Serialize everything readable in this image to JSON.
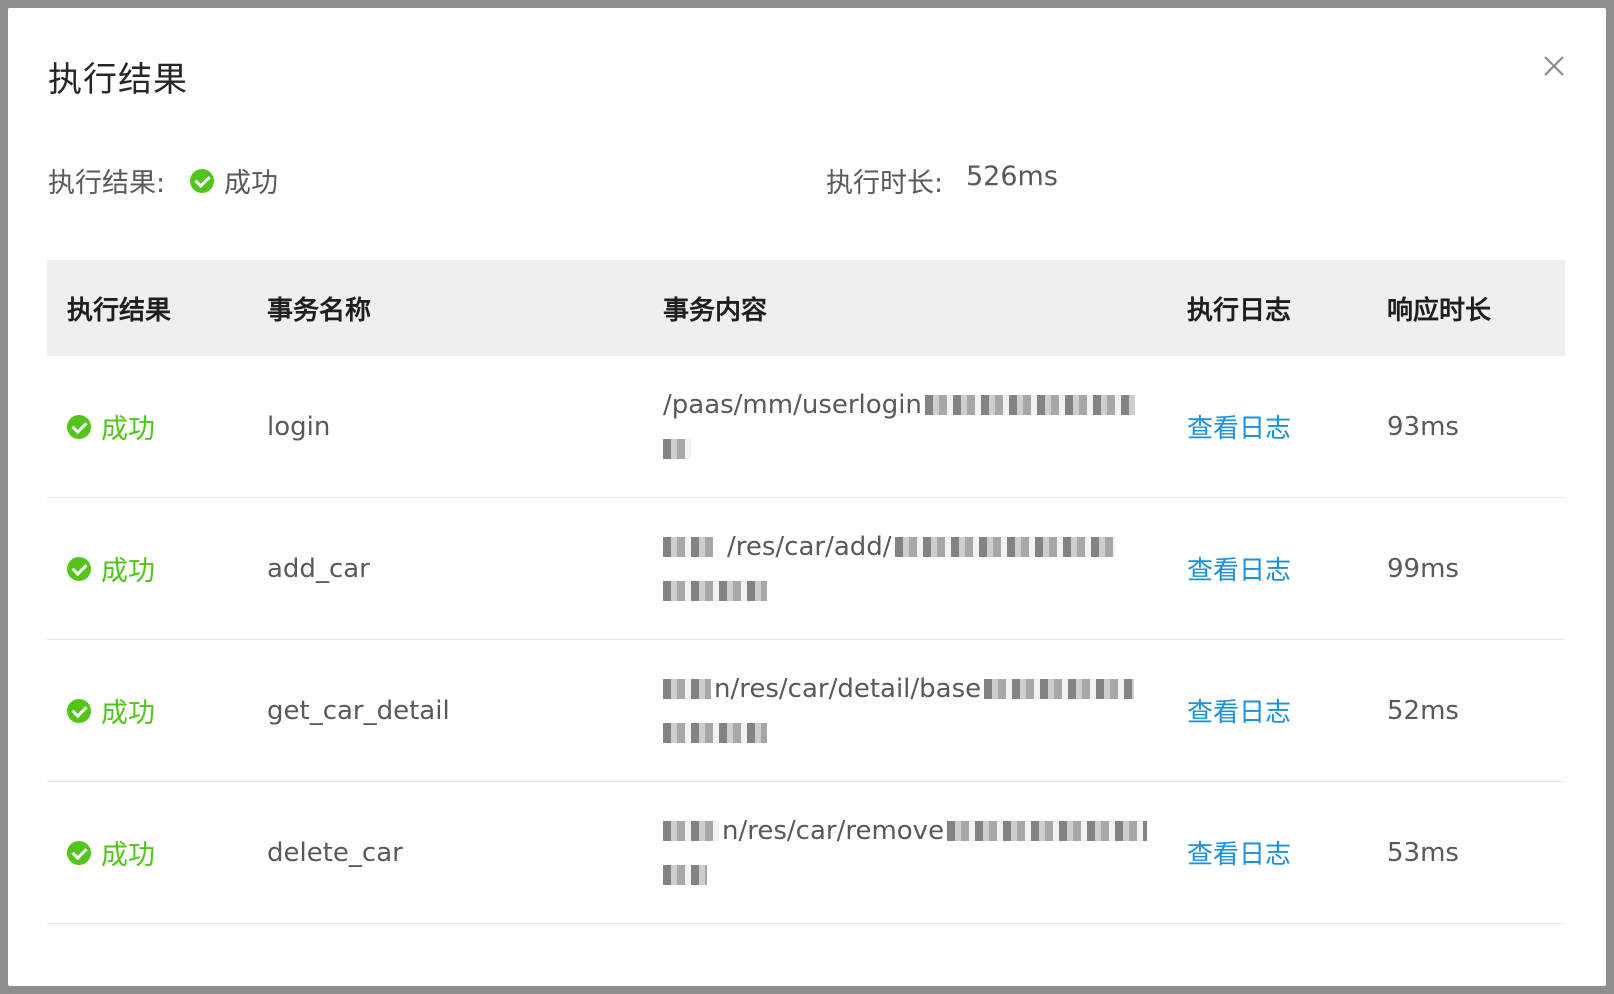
{
  "modal": {
    "title": "执行结果",
    "close_icon": "close-icon"
  },
  "summary": {
    "result_label": "执行结果:",
    "result_value": "成功",
    "duration_label": "执行时长:",
    "duration_value": "526ms"
  },
  "table": {
    "headers": [
      "执行结果",
      "事务名称",
      "事务内容",
      "执行日志",
      "响应时长"
    ],
    "rows": [
      {
        "status": "成功",
        "name": "login",
        "content": "/paas/mm/userlogin",
        "log": "查看日志",
        "time": "93ms"
      },
      {
        "status": "成功",
        "name": "add_car",
        "content": "/res/car/add/",
        "log": "查看日志",
        "time": "99ms"
      },
      {
        "status": "成功",
        "name": "get_car_detail",
        "content": "n/res/car/detail/base",
        "log": "查看日志",
        "time": "52ms"
      },
      {
        "status": "成功",
        "name": "delete_car",
        "content": "n/res/car/remove",
        "log": "查看日志",
        "time": "53ms"
      }
    ]
  },
  "colors": {
    "success": "#52c41a",
    "link": "#1a8fe6",
    "header_bg": "#efefef"
  }
}
